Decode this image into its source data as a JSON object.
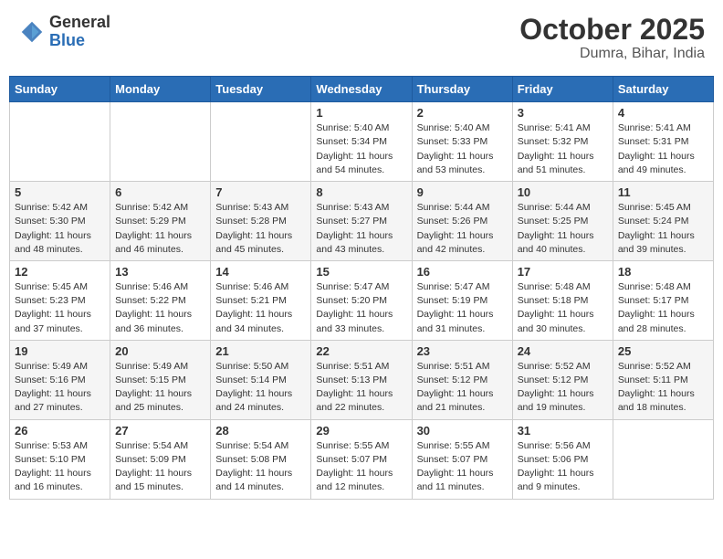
{
  "header": {
    "logo_general": "General",
    "logo_blue": "Blue",
    "month_title": "October 2025",
    "location": "Dumra, Bihar, India"
  },
  "days_of_week": [
    "Sunday",
    "Monday",
    "Tuesday",
    "Wednesday",
    "Thursday",
    "Friday",
    "Saturday"
  ],
  "weeks": [
    [
      {
        "day": "",
        "sunrise": "",
        "sunset": "",
        "daylight": ""
      },
      {
        "day": "",
        "sunrise": "",
        "sunset": "",
        "daylight": ""
      },
      {
        "day": "",
        "sunrise": "",
        "sunset": "",
        "daylight": ""
      },
      {
        "day": "1",
        "sunrise": "Sunrise: 5:40 AM",
        "sunset": "Sunset: 5:34 PM",
        "daylight": "Daylight: 11 hours and 54 minutes."
      },
      {
        "day": "2",
        "sunrise": "Sunrise: 5:40 AM",
        "sunset": "Sunset: 5:33 PM",
        "daylight": "Daylight: 11 hours and 53 minutes."
      },
      {
        "day": "3",
        "sunrise": "Sunrise: 5:41 AM",
        "sunset": "Sunset: 5:32 PM",
        "daylight": "Daylight: 11 hours and 51 minutes."
      },
      {
        "day": "4",
        "sunrise": "Sunrise: 5:41 AM",
        "sunset": "Sunset: 5:31 PM",
        "daylight": "Daylight: 11 hours and 49 minutes."
      }
    ],
    [
      {
        "day": "5",
        "sunrise": "Sunrise: 5:42 AM",
        "sunset": "Sunset: 5:30 PM",
        "daylight": "Daylight: 11 hours and 48 minutes."
      },
      {
        "day": "6",
        "sunrise": "Sunrise: 5:42 AM",
        "sunset": "Sunset: 5:29 PM",
        "daylight": "Daylight: 11 hours and 46 minutes."
      },
      {
        "day": "7",
        "sunrise": "Sunrise: 5:43 AM",
        "sunset": "Sunset: 5:28 PM",
        "daylight": "Daylight: 11 hours and 45 minutes."
      },
      {
        "day": "8",
        "sunrise": "Sunrise: 5:43 AM",
        "sunset": "Sunset: 5:27 PM",
        "daylight": "Daylight: 11 hours and 43 minutes."
      },
      {
        "day": "9",
        "sunrise": "Sunrise: 5:44 AM",
        "sunset": "Sunset: 5:26 PM",
        "daylight": "Daylight: 11 hours and 42 minutes."
      },
      {
        "day": "10",
        "sunrise": "Sunrise: 5:44 AM",
        "sunset": "Sunset: 5:25 PM",
        "daylight": "Daylight: 11 hours and 40 minutes."
      },
      {
        "day": "11",
        "sunrise": "Sunrise: 5:45 AM",
        "sunset": "Sunset: 5:24 PM",
        "daylight": "Daylight: 11 hours and 39 minutes."
      }
    ],
    [
      {
        "day": "12",
        "sunrise": "Sunrise: 5:45 AM",
        "sunset": "Sunset: 5:23 PM",
        "daylight": "Daylight: 11 hours and 37 minutes."
      },
      {
        "day": "13",
        "sunrise": "Sunrise: 5:46 AM",
        "sunset": "Sunset: 5:22 PM",
        "daylight": "Daylight: 11 hours and 36 minutes."
      },
      {
        "day": "14",
        "sunrise": "Sunrise: 5:46 AM",
        "sunset": "Sunset: 5:21 PM",
        "daylight": "Daylight: 11 hours and 34 minutes."
      },
      {
        "day": "15",
        "sunrise": "Sunrise: 5:47 AM",
        "sunset": "Sunset: 5:20 PM",
        "daylight": "Daylight: 11 hours and 33 minutes."
      },
      {
        "day": "16",
        "sunrise": "Sunrise: 5:47 AM",
        "sunset": "Sunset: 5:19 PM",
        "daylight": "Daylight: 11 hours and 31 minutes."
      },
      {
        "day": "17",
        "sunrise": "Sunrise: 5:48 AM",
        "sunset": "Sunset: 5:18 PM",
        "daylight": "Daylight: 11 hours and 30 minutes."
      },
      {
        "day": "18",
        "sunrise": "Sunrise: 5:48 AM",
        "sunset": "Sunset: 5:17 PM",
        "daylight": "Daylight: 11 hours and 28 minutes."
      }
    ],
    [
      {
        "day": "19",
        "sunrise": "Sunrise: 5:49 AM",
        "sunset": "Sunset: 5:16 PM",
        "daylight": "Daylight: 11 hours and 27 minutes."
      },
      {
        "day": "20",
        "sunrise": "Sunrise: 5:49 AM",
        "sunset": "Sunset: 5:15 PM",
        "daylight": "Daylight: 11 hours and 25 minutes."
      },
      {
        "day": "21",
        "sunrise": "Sunrise: 5:50 AM",
        "sunset": "Sunset: 5:14 PM",
        "daylight": "Daylight: 11 hours and 24 minutes."
      },
      {
        "day": "22",
        "sunrise": "Sunrise: 5:51 AM",
        "sunset": "Sunset: 5:13 PM",
        "daylight": "Daylight: 11 hours and 22 minutes."
      },
      {
        "day": "23",
        "sunrise": "Sunrise: 5:51 AM",
        "sunset": "Sunset: 5:12 PM",
        "daylight": "Daylight: 11 hours and 21 minutes."
      },
      {
        "day": "24",
        "sunrise": "Sunrise: 5:52 AM",
        "sunset": "Sunset: 5:12 PM",
        "daylight": "Daylight: 11 hours and 19 minutes."
      },
      {
        "day": "25",
        "sunrise": "Sunrise: 5:52 AM",
        "sunset": "Sunset: 5:11 PM",
        "daylight": "Daylight: 11 hours and 18 minutes."
      }
    ],
    [
      {
        "day": "26",
        "sunrise": "Sunrise: 5:53 AM",
        "sunset": "Sunset: 5:10 PM",
        "daylight": "Daylight: 11 hours and 16 minutes."
      },
      {
        "day": "27",
        "sunrise": "Sunrise: 5:54 AM",
        "sunset": "Sunset: 5:09 PM",
        "daylight": "Daylight: 11 hours and 15 minutes."
      },
      {
        "day": "28",
        "sunrise": "Sunrise: 5:54 AM",
        "sunset": "Sunset: 5:08 PM",
        "daylight": "Daylight: 11 hours and 14 minutes."
      },
      {
        "day": "29",
        "sunrise": "Sunrise: 5:55 AM",
        "sunset": "Sunset: 5:07 PM",
        "daylight": "Daylight: 11 hours and 12 minutes."
      },
      {
        "day": "30",
        "sunrise": "Sunrise: 5:55 AM",
        "sunset": "Sunset: 5:07 PM",
        "daylight": "Daylight: 11 hours and 11 minutes."
      },
      {
        "day": "31",
        "sunrise": "Sunrise: 5:56 AM",
        "sunset": "Sunset: 5:06 PM",
        "daylight": "Daylight: 11 hours and 9 minutes."
      },
      {
        "day": "",
        "sunrise": "",
        "sunset": "",
        "daylight": ""
      }
    ]
  ]
}
